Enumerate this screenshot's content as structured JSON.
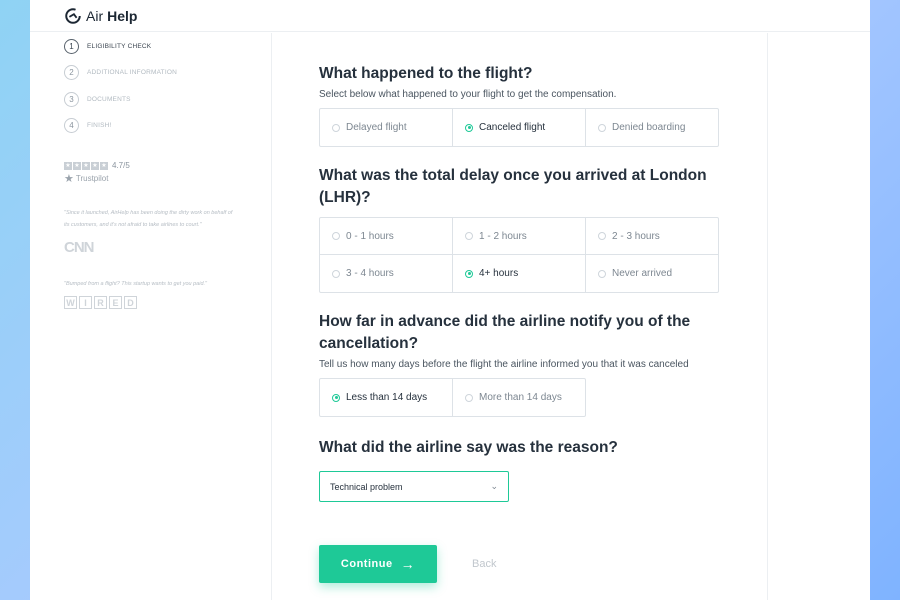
{
  "brand": {
    "logo_prefix": "Air",
    "logo_bold": "Help"
  },
  "steps": [
    {
      "num": "1",
      "label": "ELIGIBILITY CHECK"
    },
    {
      "num": "2",
      "label": "ADDITIONAL INFORMATION"
    },
    {
      "num": "3",
      "label": "DOCUMENTS"
    },
    {
      "num": "4",
      "label": "FINISH!"
    }
  ],
  "rating": {
    "value": "4.7/5",
    "source": "Trustpilot"
  },
  "press": [
    {
      "quote": "\"Since it launched, AirHelp has been doing the dirty work on behalf of its customers, and it's not afraid to take airlines to court.\"",
      "logo": "CNN"
    },
    {
      "quote": "\"Bumped from a flight? This startup wants to get you paid.\"",
      "logo": "WIRED"
    }
  ],
  "q1": {
    "title": "What happened to the flight?",
    "subtitle": "Select below what happened to your flight to get the compensation.",
    "options": [
      "Delayed flight",
      "Canceled flight",
      "Denied boarding"
    ],
    "selected": "Canceled flight"
  },
  "q2": {
    "title": "What was the total delay once you arrived at London (LHR)?",
    "options": [
      "0 - 1 hours",
      "1 - 2 hours",
      "2 - 3 hours",
      "3 - 4 hours",
      "4+ hours",
      "Never arrived"
    ],
    "selected": "4+ hours"
  },
  "q3": {
    "title": "How far in advance did the airline notify you of the cancellation?",
    "subtitle": "Tell us how many days before the flight the airline informed you that it was canceled",
    "options": [
      "Less than 14 days",
      "More than 14 days"
    ],
    "selected": "Less than 14 days"
  },
  "q4": {
    "title": "What did the airline say was the reason?",
    "select_value": "Technical problem"
  },
  "actions": {
    "continue_label": "Continue",
    "back_label": "Back"
  },
  "colors": {
    "accent": "#1ec997",
    "text": "#26313d"
  }
}
